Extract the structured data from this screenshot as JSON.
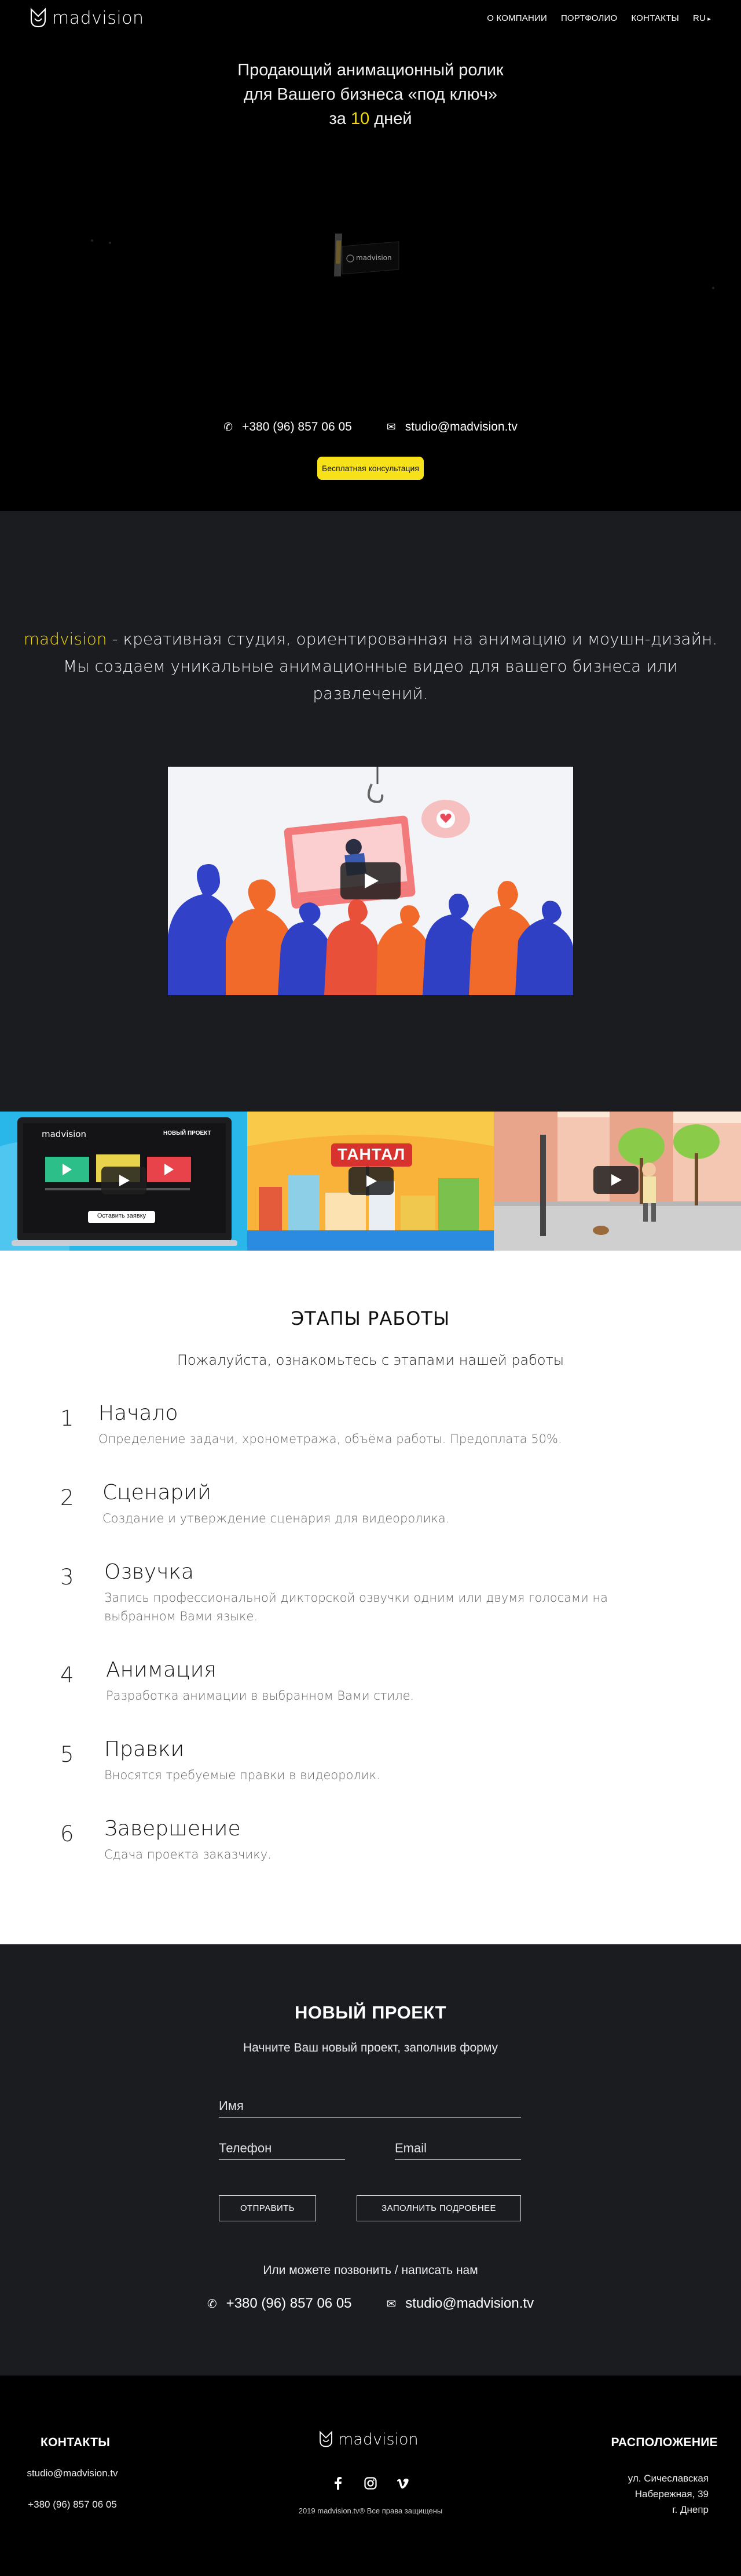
{
  "header": {
    "logo_text": "madvision",
    "menu": [
      "О КОМПАНИИ",
      "ПОРТФОЛИО",
      "КОНТАКТЫ",
      "RU"
    ]
  },
  "hero": {
    "title_line1": "Продающий анимационный ролик",
    "title_line2": "для Вашего бизнеса «под ключ»",
    "title_line3_prefix": "за ",
    "title_line3_num": "10",
    "title_line3_suffix": " дней",
    "reel_logo": "madvision",
    "phone": "+380 (96) 857 06 05",
    "email": "studio@madvision.tv",
    "consult_button": "Бесплатная консультация"
  },
  "about": {
    "brand": "madvision",
    "text": " - креативная студия, ориентированная на анимацию и моушн-дизайн. Мы создаем уникальные анимационные видео для вашего бизнеса или развлечений."
  },
  "portfolio": {
    "thumb1_logo": "madvision",
    "thumb1_badge": "НОВЫЙ ПРОЕКТ",
    "thumb1_button": "Оставить заявку",
    "thumb2_sign": "ТАНТАЛ"
  },
  "stages": {
    "title": "ЭТАПЫ РАБОТЫ",
    "subtitle": "Пожалуйста, ознакомьтесь с этапами нашей работы",
    "steps": [
      {
        "num": "1",
        "title": "Начало",
        "desc": "Определение задачи, хронометража, объёма работы. Предоплата 50%."
      },
      {
        "num": "2",
        "title": "Сценарий",
        "desc": "Создание и утверждение сценария для видеоролика."
      },
      {
        "num": "3",
        "title": "Озвучка",
        "desc": "Запись профессиональной дикторской озвучки одним или двумя голосами на выбранном Вами языке."
      },
      {
        "num": "4",
        "title": "Анимация",
        "desc": "Разработка анимации в выбранном Вами стиле."
      },
      {
        "num": "5",
        "title": "Правки",
        "desc": "Вносятся требуемые правки в видеоролик."
      },
      {
        "num": "6",
        "title": "Завершение",
        "desc": "Сдача проекта заказчику."
      }
    ]
  },
  "project": {
    "title": "НОВЫЙ ПРОЕКТ",
    "subtitle": "Начните Ваш новый проект, заполнив форму",
    "name_placeholder": "Имя",
    "phone_placeholder": "Телефон",
    "email_placeholder": "Email",
    "send_button": "ОТПРАВИТЬ",
    "detail_button": "ЗАПОЛНИТЬ ПОДРОБНЕЕ",
    "or_text": "Или можете позвонить / написать нам",
    "phone": "+380 (96) 857 06 05",
    "email": "studio@madvision.tv"
  },
  "footer": {
    "contacts_title": "КОНТАКТЫ",
    "email": "studio@madvision.tv",
    "phone": "+380 (96) 857 06 05",
    "logo_text": "madvision",
    "copyright": "2019 madvision.tv® Все права защищены",
    "location_title": "РАСПОЛОЖЕНИЕ",
    "address_line1": "ул. Сичеславская",
    "address_line2": "Набережная, 39",
    "address_line3": "г. Днепр"
  },
  "colors": {
    "accent": "#f5d90a",
    "button_yellow": "#f7e21a",
    "dark_bg": "#1b1c20"
  },
  "icons": [
    "logo-icon",
    "phone-icon",
    "mail-icon",
    "play-icon",
    "heart-icon",
    "facebook-icon",
    "instagram-icon",
    "vimeo-icon"
  ]
}
